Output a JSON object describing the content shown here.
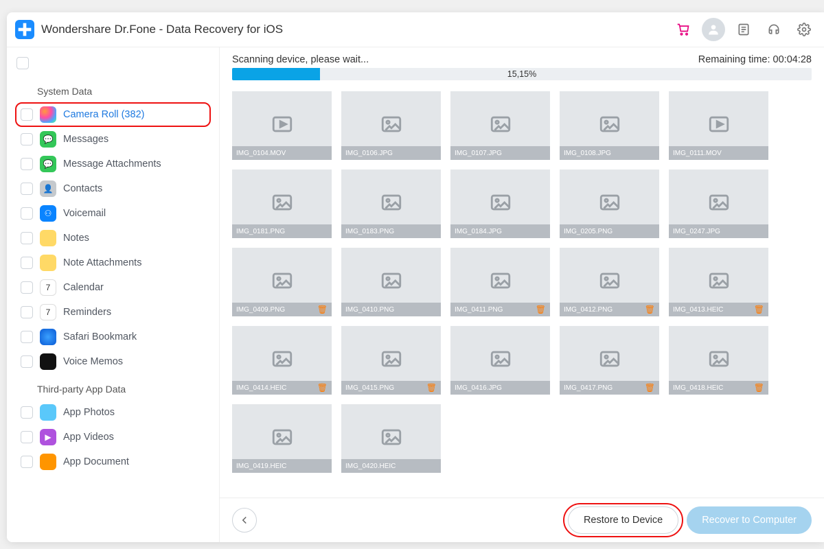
{
  "app": {
    "title": "Wondershare Dr.Fone - Data Recovery for iOS"
  },
  "scan": {
    "status": "Scanning device, please wait...",
    "remaining_prefix": "Remaining time: ",
    "remaining_value": "00:04:28",
    "percent_text": "15,15%",
    "percent_value": 15.15
  },
  "sidebar": {
    "section1_title": "System Data",
    "section2_title": "Third-party App Data",
    "items": [
      {
        "label": "Camera Roll (382)",
        "selected": true
      },
      {
        "label": "Messages"
      },
      {
        "label": "Message Attachments"
      },
      {
        "label": "Contacts"
      },
      {
        "label": "Voicemail"
      },
      {
        "label": "Notes"
      },
      {
        "label": "Note Attachments"
      },
      {
        "label": "Calendar"
      },
      {
        "label": "Reminders"
      },
      {
        "label": "Safari Bookmark"
      },
      {
        "label": "Voice Memos"
      }
    ],
    "third_party": [
      {
        "label": "App Photos"
      },
      {
        "label": "App Videos"
      },
      {
        "label": "App Document"
      }
    ]
  },
  "thumbs": [
    {
      "name": "IMG_0104.MOV",
      "type": "video"
    },
    {
      "name": "IMG_0106.JPG",
      "type": "image"
    },
    {
      "name": "IMG_0107.JPG",
      "type": "image"
    },
    {
      "name": "IMG_0108.JPG",
      "type": "image"
    },
    {
      "name": "IMG_0111.MOV",
      "type": "video"
    },
    {
      "name": "IMG_0181.PNG",
      "type": "image"
    },
    {
      "name": "IMG_0183.PNG",
      "type": "image"
    },
    {
      "name": "IMG_0184.JPG",
      "type": "image"
    },
    {
      "name": "IMG_0205.PNG",
      "type": "image"
    },
    {
      "name": "IMG_0247.JPG",
      "type": "image"
    },
    {
      "name": "IMG_0409.PNG",
      "type": "image",
      "trash": true
    },
    {
      "name": "IMG_0410.PNG",
      "type": "image"
    },
    {
      "name": "IMG_0411.PNG",
      "type": "image",
      "trash": true
    },
    {
      "name": "IMG_0412.PNG",
      "type": "image",
      "trash": true
    },
    {
      "name": "IMG_0413.HEIC",
      "type": "image",
      "trash": true
    },
    {
      "name": "IMG_0414.HEIC",
      "type": "image",
      "trash": true
    },
    {
      "name": "IMG_0415.PNG",
      "type": "image",
      "trash": true
    },
    {
      "name": "IMG_0416.JPG",
      "type": "image"
    },
    {
      "name": "IMG_0417.PNG",
      "type": "image",
      "trash": true
    },
    {
      "name": "IMG_0418.HEIC",
      "type": "image",
      "trash": true
    },
    {
      "name": "IMG_0419.HEIC",
      "type": "image"
    },
    {
      "name": "IMG_0420.HEIC",
      "type": "image"
    }
  ],
  "footer": {
    "restore_label": "Restore to Device",
    "recover_label": "Recover to Computer"
  }
}
